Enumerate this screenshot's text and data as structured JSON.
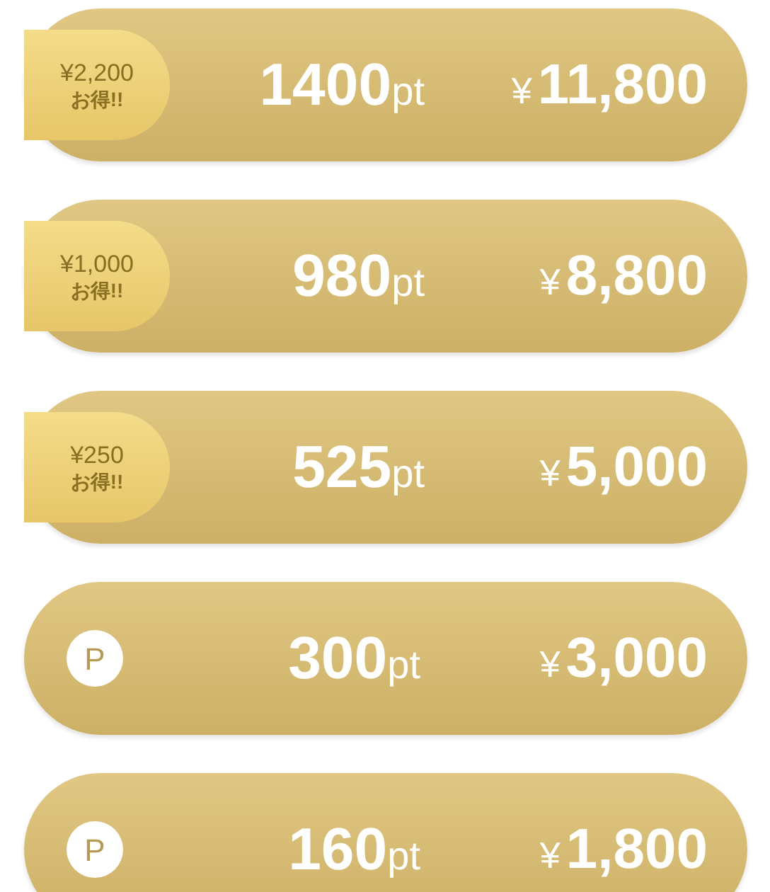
{
  "plans": [
    {
      "kind": "bonus",
      "badge_amount": "¥2,200",
      "badge_note": "お得!!",
      "points": "1400",
      "unit": "pt",
      "currency": "¥",
      "price": "11,800"
    },
    {
      "kind": "bonus",
      "badge_amount": "¥1,000",
      "badge_note": "お得!!",
      "points": "980",
      "unit": "pt",
      "currency": "¥",
      "price": "8,800"
    },
    {
      "kind": "bonus",
      "badge_amount": "¥250",
      "badge_note": "お得!!",
      "points": "525",
      "unit": "pt",
      "currency": "¥",
      "price": "5,000"
    },
    {
      "kind": "point",
      "mark": "P",
      "points": "300",
      "unit": "pt",
      "currency": "¥",
      "price": "3,000"
    },
    {
      "kind": "point",
      "mark": "P",
      "points": "160",
      "unit": "pt",
      "currency": "¥",
      "price": "1,800"
    }
  ]
}
